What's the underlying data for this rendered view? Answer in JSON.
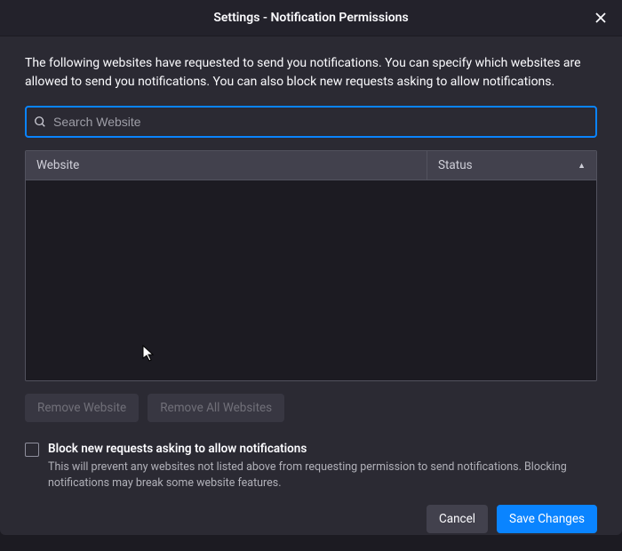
{
  "dialog": {
    "title": "Settings - Notification Permissions",
    "description": "The following websites have requested to send you notifications. You can specify which websites are allowed to send you notifications. You can also block new requests asking to allow notifications."
  },
  "search": {
    "placeholder": "Search Website",
    "value": ""
  },
  "table": {
    "columns": {
      "website": "Website",
      "status": "Status"
    },
    "rows": []
  },
  "actions": {
    "remove_website": "Remove Website",
    "remove_all": "Remove All Websites"
  },
  "block_checkbox": {
    "label": "Block new requests asking to allow notifications",
    "help": "This will prevent any websites not listed above from requesting permission to send notifications. Blocking notifications may break some website features."
  },
  "footer": {
    "cancel": "Cancel",
    "save": "Save Changes"
  }
}
